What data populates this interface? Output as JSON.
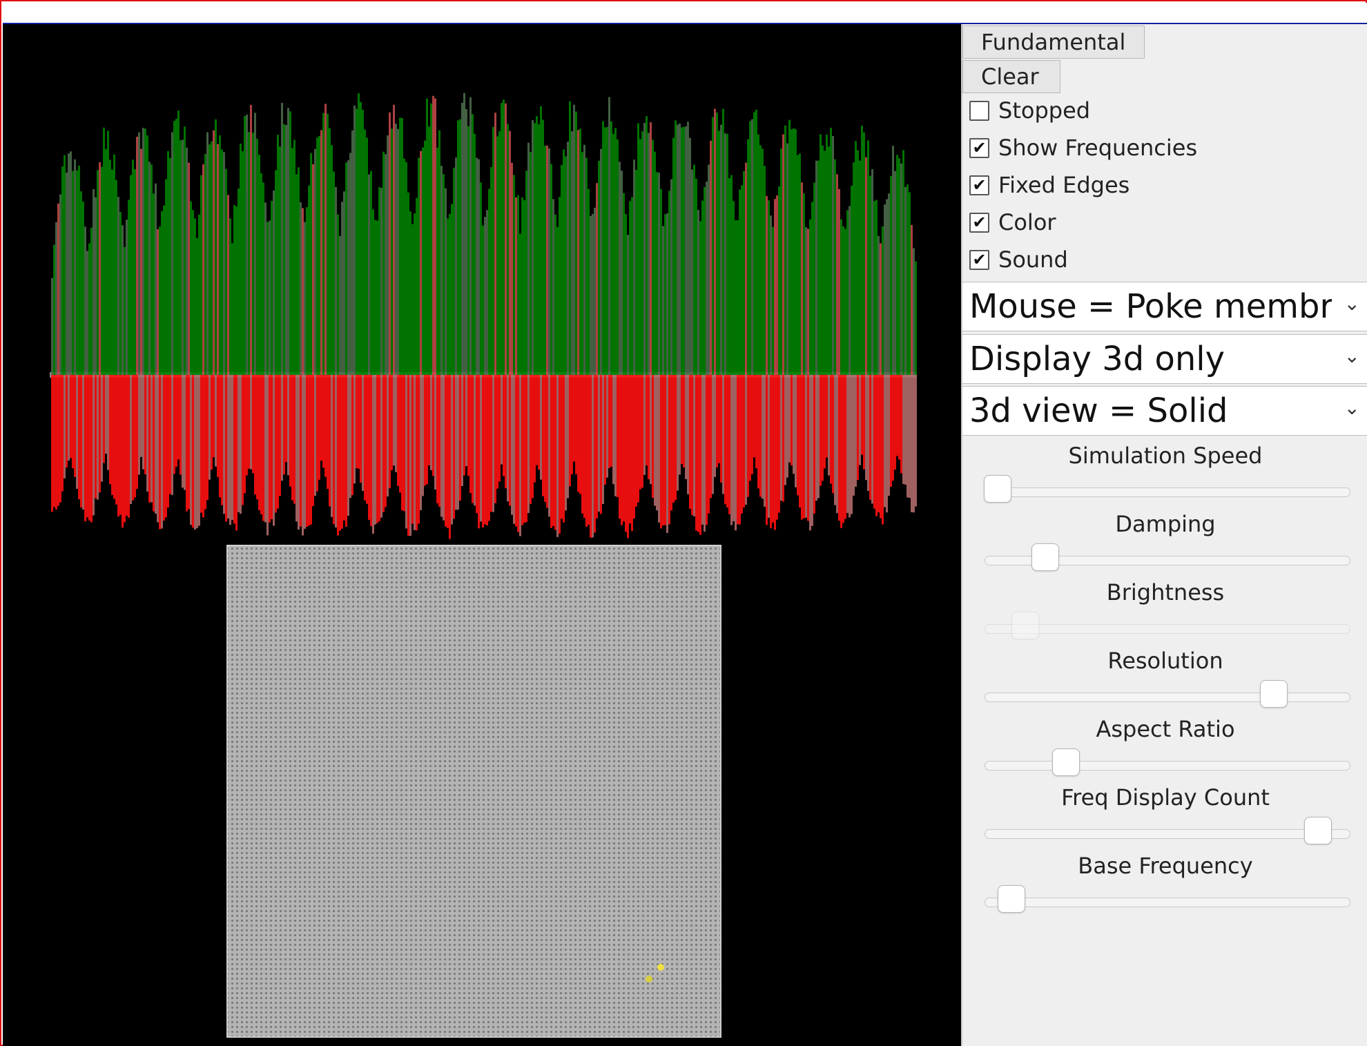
{
  "buttons": {
    "fundamental": "Fundamental",
    "clear": "Clear"
  },
  "checkboxes": [
    {
      "label": "Stopped",
      "checked": false
    },
    {
      "label": "Show Frequencies",
      "checked": true
    },
    {
      "label": "Fixed Edges",
      "checked": true
    },
    {
      "label": "Color",
      "checked": true
    },
    {
      "label": "Sound",
      "checked": true
    }
  ],
  "selects": {
    "mouse": "Mouse = Poke membrane",
    "display": "Display 3d only",
    "view": "3d view = Solid"
  },
  "sliders": [
    {
      "label": "Simulation Speed",
      "value": 0.0
    },
    {
      "label": "Damping",
      "value": 0.14
    },
    {
      "label": "Brightness",
      "value": 0.08,
      "disabled": true
    },
    {
      "label": "Resolution",
      "value": 0.81
    },
    {
      "label": "Aspect Ratio",
      "value": 0.2
    },
    {
      "label": "Freq Display Count",
      "value": 0.94
    },
    {
      "label": "Base Frequency",
      "value": 0.04
    }
  ],
  "colors": {
    "wave_positive": "#008000",
    "wave_negative": "#ff1010",
    "membrane_grid": "#b4b4b4",
    "membrane_dots": "#7a7a7a",
    "probe": "#f0e040",
    "background": "#000000"
  },
  "icons": {
    "checkmark": "check-icon",
    "dropdown": "chevron-down-icon"
  }
}
